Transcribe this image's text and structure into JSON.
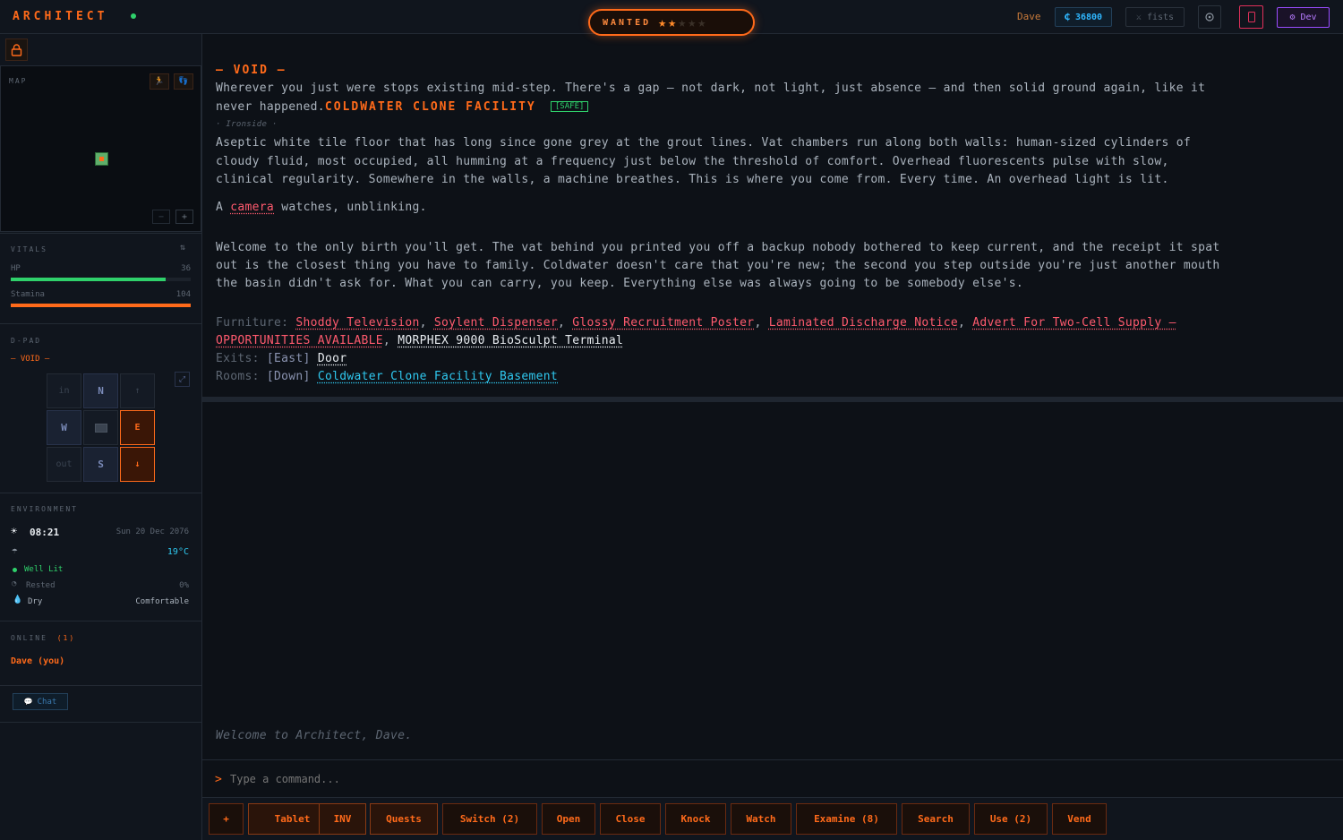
{
  "topbar": {
    "logo": "ARCHITECT",
    "wanted_label": "WANTED",
    "wanted_level": 2,
    "wanted_max": 5,
    "username": "Dave",
    "credits": "₵ 36800",
    "weapon": "⚔ fists",
    "dev_label": "⚙ Dev"
  },
  "sidebar": {
    "map": {
      "title": "MAP"
    },
    "vitals": {
      "title": "VITALS",
      "hp_label": "HP",
      "hp_value": "36",
      "hp_fraction": 0.86,
      "stamina_label": "Stamina",
      "stamina_value": "104",
      "stamina_fraction": 1.0
    },
    "dpad": {
      "title": "D-PAD",
      "location": "— VOID —",
      "in": "in",
      "north": "N",
      "up": "↑",
      "west": "W",
      "east": "E",
      "out": "out",
      "south": "S",
      "down": "↓"
    },
    "environment": {
      "title": "ENVIRONMENT",
      "time": "08:21",
      "date": "Sun 20 Dec 2076",
      "temp": "19°C",
      "light": "Well Lit",
      "rest": "Rested",
      "rest_pct": "0%",
      "humidity": "Dry",
      "comfort": "Comfortable"
    },
    "online": {
      "title": "ONLINE",
      "count": "(1)",
      "user": "Dave (you)"
    },
    "chat_label": "Chat"
  },
  "main": {
    "void_title": "— VOID —",
    "void_line1": "Wherever you just were stops existing mid-step. There's a gap — not dark, not light, just absence — and then solid ground again, like it",
    "void_line2": "never happened.",
    "facility_name": "COLDWATER CLONE FACILITY",
    "safe_badge": "[SAFE]",
    "district": "· Ironside ·",
    "room_desc": [
      "Aseptic white tile floor that has long since gone grey at the grout lines. Vat chambers run along both walls: human-sized cylinders of",
      "cloudy fluid, most occupied, all humming at a frequency just below the threshold of comfort. Overhead fluorescents pulse with slow,",
      "clinical regularity. Somewhere in the walls, a machine breathes. This is where you come from. Every time. An overhead light is lit."
    ],
    "camera_prefix": "A",
    "camera_link": "camera",
    "camera_suffix": "watches, unblinking.",
    "welcome": [
      "Welcome to the only birth you'll get. The vat behind you printed you off a backup nobody bothered to keep current, and the receipt it spat",
      "out is the closest thing you have to family. Coldwater doesn't care that you're new; the second you step outside you're just another mouth",
      "the basin didn't ask for. What you can carry, you keep. Everything else was always going to be somebody else's."
    ],
    "furniture_label": "Furniture:",
    "furniture": [
      "Shoddy Television",
      "Soylent Dispenser",
      "Glossy Recruitment Poster",
      "Laminated Discharge Notice",
      "Advert For Two-Cell Supply —",
      "OPPORTUNITIES AVAILABLE",
      "MORPHEX 9000 BioSculpt Terminal"
    ],
    "exits_label": "Exits:",
    "exit_dir": "[East]",
    "exit_name": "Door",
    "rooms_label": "Rooms:",
    "room_dir": "[Down]",
    "room_name": "Coldwater Clone Facility Basement",
    "log_message": "Welcome to Architect, Dave.",
    "command_prompt": ">",
    "command_placeholder": "Type a command..."
  },
  "actions": {
    "add": "+",
    "tablet": "Tablet",
    "inv": "INV",
    "quests": "Quests",
    "switch": "Switch (2)",
    "open": "Open",
    "close": "Close",
    "knock": "Knock",
    "watch": "Watch",
    "examine": "Examine (8)",
    "search": "Search",
    "use": "Use (2)",
    "vend": "Vend"
  },
  "colors": {
    "accent": "#ff6a1a",
    "hp": "#2fd16b",
    "stamina": "#ff6a1a",
    "link_red": "#ff5a6e",
    "link_cyan": "#2fc8ef"
  }
}
